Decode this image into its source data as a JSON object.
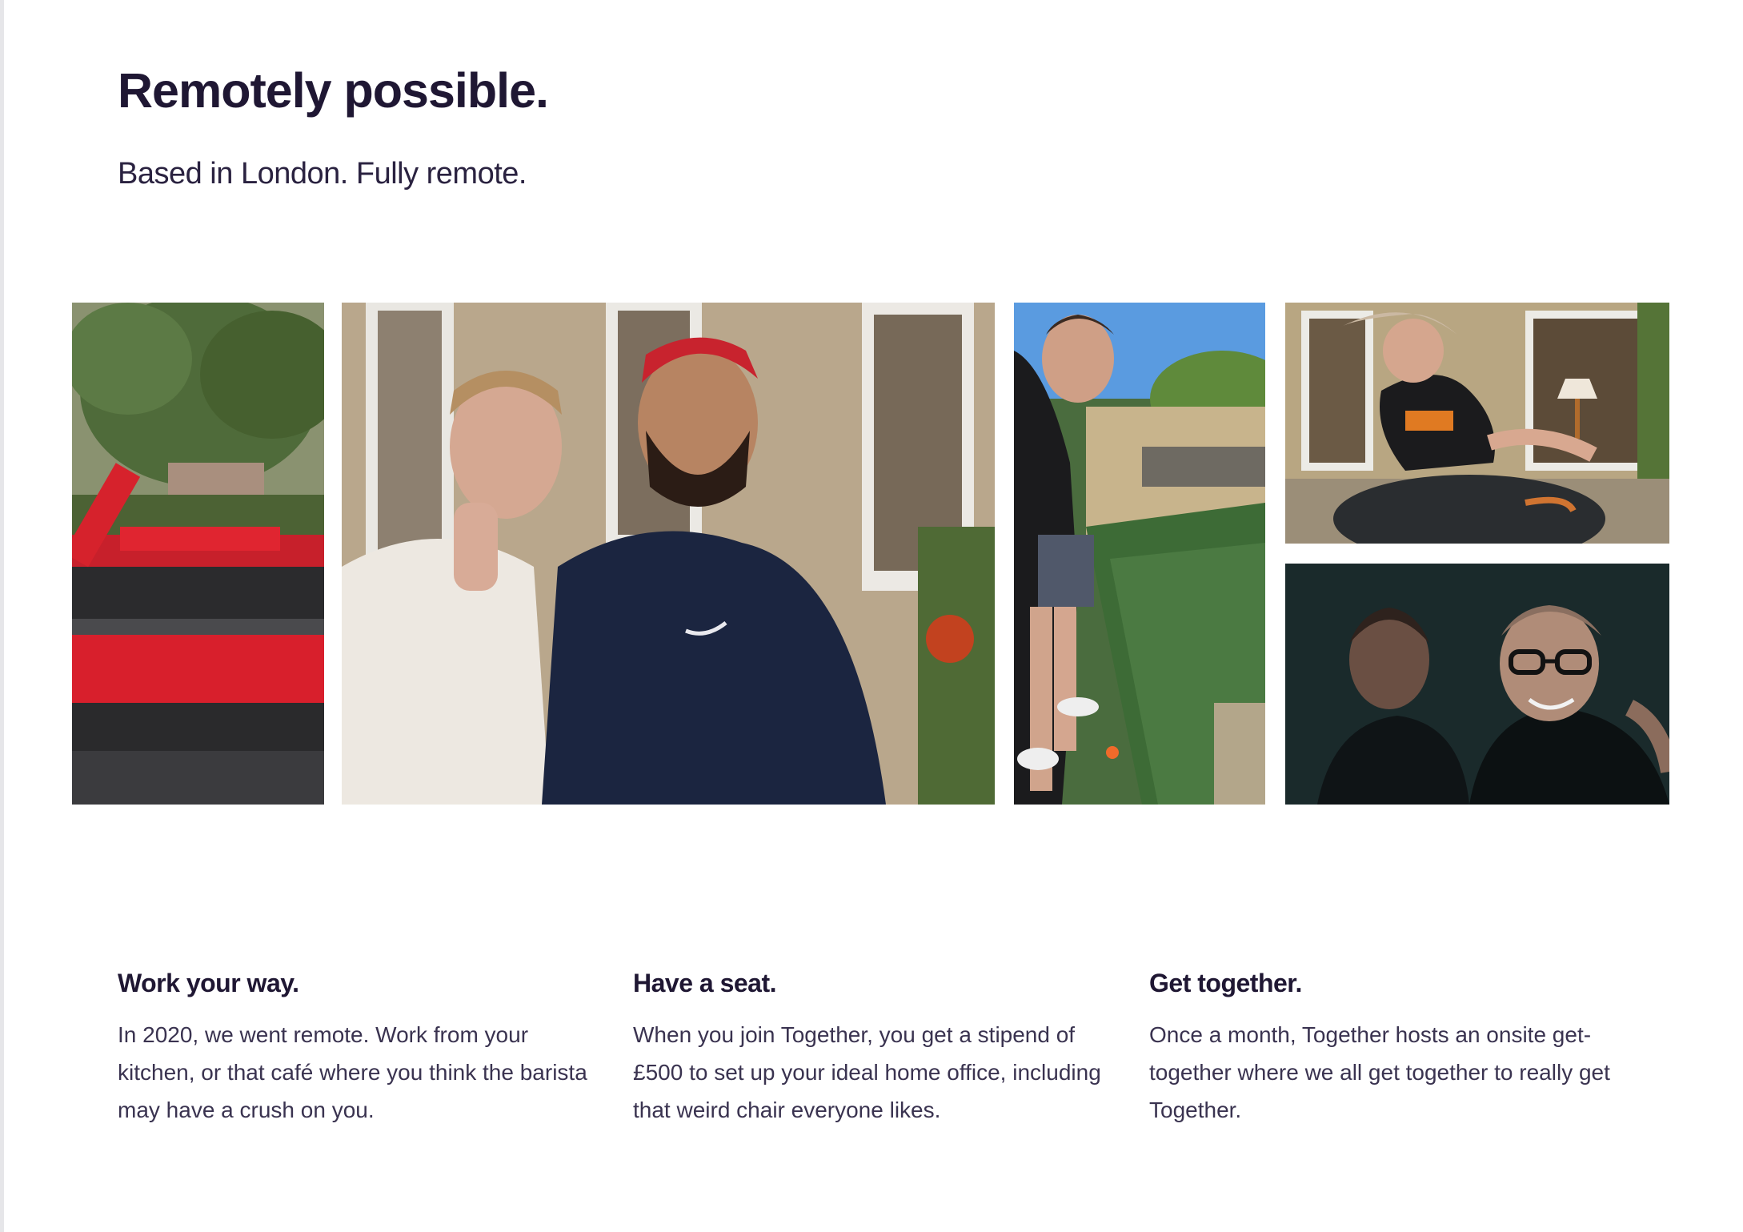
{
  "hero": {
    "title": "Remotely possible.",
    "subtitle": "Based in London. Fully remote."
  },
  "gallery": {
    "photos": [
      {
        "subject": "inflatable-red-black-ring"
      },
      {
        "subject": "two-men-smiling-garden"
      },
      {
        "subject": "man-playing-mini-golf"
      },
      {
        "subject": "woman-riding-mechanical-bull"
      },
      {
        "subject": "two-men-smiling-dark"
      }
    ]
  },
  "features": [
    {
      "title": "Work your way.",
      "body": "In 2020, we went remote. Work from your kitchen, or that café where you think the barista may have a crush on you."
    },
    {
      "title": "Have a seat.",
      "body": "When you join Together, you get a stipend of £500 to set up your ideal home office, including that weird chair everyone likes."
    },
    {
      "title": "Get together.",
      "body": "Once a month, Together hosts an onsite get-together where we all get together to really get Together."
    }
  ],
  "colors": {
    "text_primary": "#1f1733",
    "text_body": "#3a3350",
    "background": "#ffffff"
  }
}
